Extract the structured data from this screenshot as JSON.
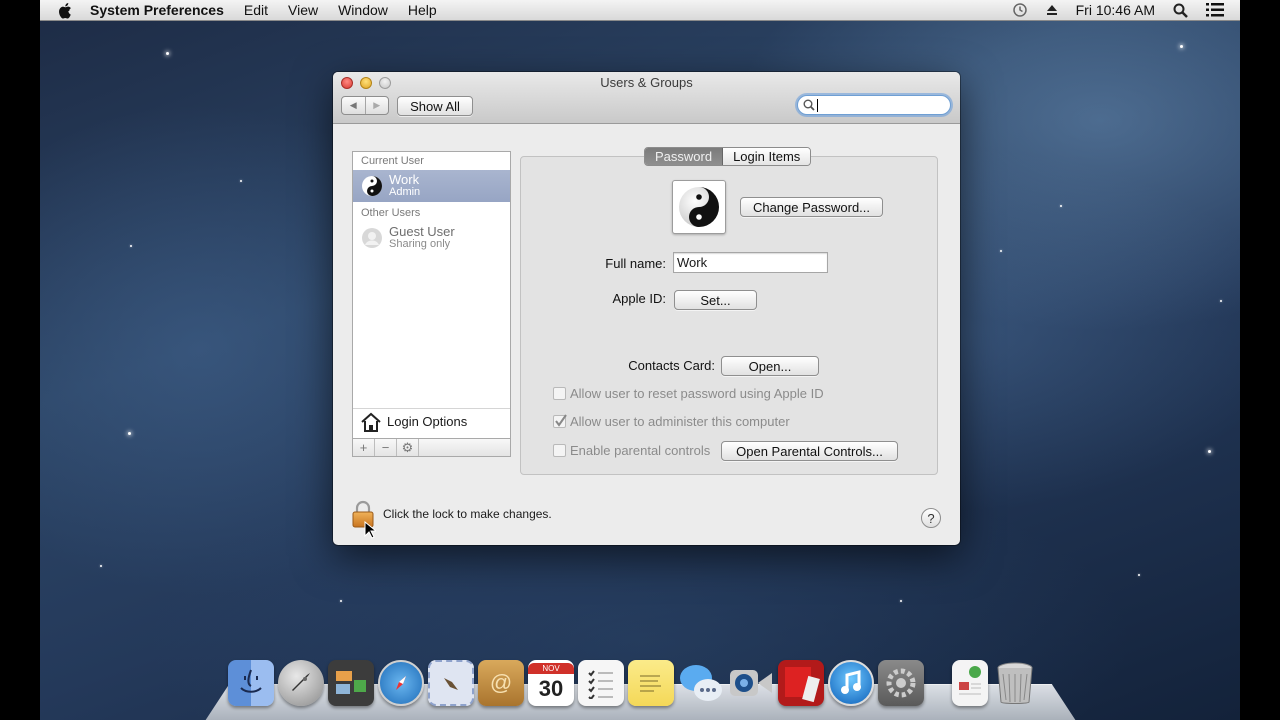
{
  "menubar": {
    "app_name": "System Preferences",
    "menus": [
      "Edit",
      "View",
      "Window",
      "Help"
    ],
    "clock": "Fri 10:46 AM",
    "status_icons": [
      "time-machine-icon",
      "eject-icon",
      "spotlight-search-icon",
      "notification-center-icon"
    ]
  },
  "window": {
    "title": "Users & Groups",
    "show_all_label": "Show All",
    "back_label": "◀",
    "forward_label": "▶",
    "search": {
      "value": "",
      "placeholder": ""
    }
  },
  "sidebar": {
    "current_header": "Current User",
    "other_header": "Other Users",
    "users": [
      {
        "name": "Work",
        "role": "Admin",
        "selected": true
      },
      {
        "name": "Guest User",
        "role": "Sharing only",
        "selected": false
      }
    ],
    "login_options": "Login Options",
    "add_label": "+",
    "remove_label": "−",
    "action_label": "⚙"
  },
  "tabs": [
    {
      "label": "Password",
      "active": true
    },
    {
      "label": "Login Items",
      "active": false
    }
  ],
  "password_pane": {
    "change_password": "Change Password...",
    "full_name_label": "Full name:",
    "full_name_value": "Work",
    "apple_id_label": "Apple ID:",
    "apple_id_button": "Set...",
    "contacts_label": "Contacts Card:",
    "contacts_button": "Open...",
    "checkboxes": [
      {
        "label": "Allow user to reset password using Apple ID",
        "checked": false,
        "enabled": false
      },
      {
        "label": "Allow user to administer this computer",
        "checked": true,
        "enabled": false
      },
      {
        "label": "Enable parental controls",
        "checked": false,
        "enabled": false
      }
    ],
    "parental_button": "Open Parental Controls..."
  },
  "footer": {
    "lock_text": "Click the lock to make changes.",
    "help_label": "?"
  },
  "dock": {
    "calendar_month": "NOV",
    "calendar_day": "30",
    "apps": [
      "Finder",
      "Launchpad",
      "Mission Control",
      "Safari",
      "Mail",
      "Contacts",
      "Calendar",
      "Reminders",
      "Notes",
      "Messages",
      "FaceTime",
      "Photo Booth",
      "iTunes",
      "System Preferences",
      "Document",
      "Trash"
    ]
  }
}
